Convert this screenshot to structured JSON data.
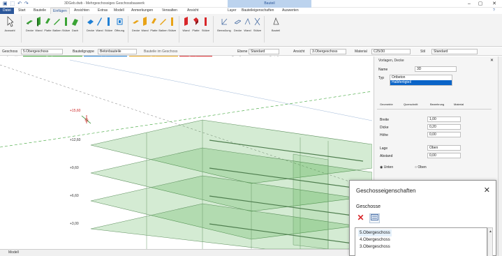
{
  "titlebar": {
    "title": "3DGeb.dwb - Mehrgeschossiges Geschossbauwerk",
    "context_tab": "Bauteil",
    "minimize": "–",
    "restore": "▢",
    "close": "✕",
    "help": "?"
  },
  "tabs": [
    {
      "label": "Datei"
    },
    {
      "label": "Start"
    },
    {
      "label": "Bauteile"
    },
    {
      "label": "Einfügen"
    },
    {
      "label": "Ansichten"
    },
    {
      "label": "Extras"
    },
    {
      "label": "Modell"
    },
    {
      "label": "Anmerkungen"
    },
    {
      "label": "Verwalten"
    },
    {
      "label": "Ansicht"
    },
    {
      "label": "Layer"
    },
    {
      "label": "Bauteileigenschaften"
    },
    {
      "label": "Auswerten"
    }
  ],
  "ribbon": {
    "buttons": [
      {
        "label": "Auswahl",
        "icon": "cursor-icon"
      },
      {
        "label": "Decke",
        "icon": "slab-icon"
      },
      {
        "label": "Wand",
        "icon": "wall-icon"
      },
      {
        "label": "Platte",
        "icon": "plate-icon"
      },
      {
        "label": "Balken",
        "icon": "beam-icon"
      },
      {
        "label": "Stütze",
        "icon": "column-icon"
      },
      {
        "label": "Dach",
        "icon": "roof-icon"
      },
      {
        "label": "Decke",
        "icon": "slab-icon"
      },
      {
        "label": "Wand",
        "icon": "wall-icon"
      },
      {
        "label": "Stütze",
        "icon": "column-icon"
      },
      {
        "label": "Öffnung",
        "icon": "opening-icon"
      },
      {
        "label": "Decke",
        "icon": "slab-icon"
      },
      {
        "label": "Wand",
        "icon": "wall-icon"
      },
      {
        "label": "Platte",
        "icon": "plate-icon"
      },
      {
        "label": "Balken",
        "icon": "beam-icon"
      },
      {
        "label": "Stütze",
        "icon": "column-icon"
      },
      {
        "label": "Wand",
        "icon": "wall-icon"
      },
      {
        "label": "Platte",
        "icon": "plate-icon"
      },
      {
        "label": "Stütze",
        "icon": "column-icon"
      },
      {
        "label": "Bemaßung",
        "icon": "dimension-icon"
      },
      {
        "label": "Decke",
        "icon": "slab-icon"
      },
      {
        "label": "Wand",
        "icon": "wall-icon"
      },
      {
        "label": "Stütze",
        "icon": "column-icon"
      },
      {
        "label": "Bauteil",
        "icon": "element-icon"
      }
    ],
    "groups": [
      {
        "label": "Auswahl",
        "color": "#ffffff",
        "text_color": "#333333"
      },
      {
        "label": "Positionen",
        "color": "#3aa335",
        "text_color": "#ffffff"
      },
      {
        "label": "Lasten",
        "color": "#1f7fd4",
        "text_color": "#ffffff"
      },
      {
        "label": "Dach",
        "color": "#e8a317",
        "text_color": "#ffffff"
      },
      {
        "label": "Bewehrung",
        "color": "#d8262a",
        "text_color": "#ffffff"
      },
      {
        "label": "Bemaßung",
        "color": "#f3f3f3",
        "text_color": "#333333"
      },
      {
        "label": "Bauteiltyp",
        "color": "#f3f3f3",
        "text_color": "#333333"
      }
    ]
  },
  "optbar": {
    "geschoss_label": "Geschoss",
    "geschoss_value": "5.Obergeschoss",
    "bauteilgruppe_label": "Bauteilgruppe",
    "bauteilgruppe_value": "Betonbauteile",
    "info_text": "Bauteile im Geschoss",
    "ebene_label": "Ebene",
    "ebene_value": "Standard",
    "ansicht_label": "Ansicht",
    "ansicht_value": "3.Obergeschoss",
    "material_label": "Material",
    "material_value": "C25/30",
    "stil_label": "Stil",
    "stil_value": "Standard"
  },
  "viewport": {
    "level_labels": [
      "+15,60",
      "+12,60",
      "+9,60",
      "+6,60",
      "+3,00"
    ]
  },
  "tabbar": {
    "label": "Modell"
  },
  "panel": {
    "title": "Vorlagen, Decke",
    "name_label": "Name",
    "name_value": "3D",
    "type_label": "Typ",
    "list_items": [
      "Ortbeton",
      "Halbfertigteil"
    ],
    "tab_labels": [
      "Geometrie",
      "Querschnitt",
      "Bewehrung",
      "Material",
      "Lasten",
      "Darstellung"
    ],
    "fields": [
      {
        "label": "Breite",
        "value": "1,00"
      },
      {
        "label": "Dicke",
        "value": "0,20"
      },
      {
        "label": "Höhe",
        "value": "0,00"
      },
      {
        "label": "Lage",
        "value": "Oben"
      },
      {
        "label": "Abstand",
        "value": "0,00"
      }
    ],
    "radio_options": [
      "Unten",
      "Oben"
    ],
    "vstrip_labels": [
      "Eigenschaften",
      "Objekte"
    ]
  },
  "dialog": {
    "title": "Geschosseigenschaften",
    "close": "✕",
    "section": "Geschosse",
    "items": [
      {
        "label": "5.Obergeschoss",
        "selected": true
      },
      {
        "label": "4.Obergeschoss",
        "selected": false
      },
      {
        "label": "3.Obergeschoss",
        "selected": false
      }
    ]
  }
}
